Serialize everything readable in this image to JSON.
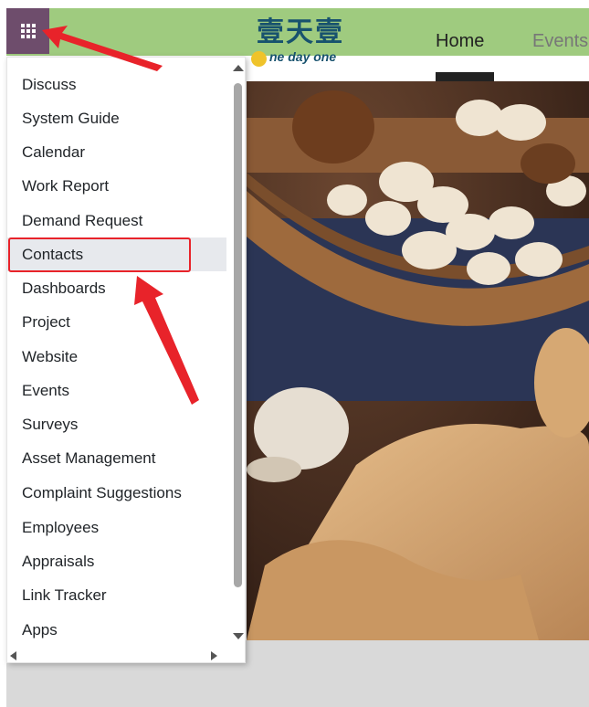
{
  "header": {
    "apps_icon": "grid-icon",
    "logo_cn": "壹天壹",
    "logo_en": "ne day one",
    "nav": [
      {
        "label": "Home"
      },
      {
        "label": "Events"
      }
    ]
  },
  "app_menu": {
    "items": [
      {
        "label": "Discuss"
      },
      {
        "label": "System Guide"
      },
      {
        "label": "Calendar"
      },
      {
        "label": "Work Report"
      },
      {
        "label": "Demand Request"
      },
      {
        "label": "Contacts"
      },
      {
        "label": "Dashboards"
      },
      {
        "label": "Project"
      },
      {
        "label": "Website"
      },
      {
        "label": "Events"
      },
      {
        "label": "Surveys"
      },
      {
        "label": "Asset Management"
      },
      {
        "label": "Complaint Suggestions"
      },
      {
        "label": "Employees"
      },
      {
        "label": "Appraisals"
      },
      {
        "label": "Link Tracker"
      },
      {
        "label": "Apps"
      }
    ],
    "highlighted": "Contacts"
  },
  "colors": {
    "topbar": "#9fcb7f",
    "apps_button": "#6e4d6c",
    "annotation": "#e8232a",
    "logo": "#17526e"
  }
}
